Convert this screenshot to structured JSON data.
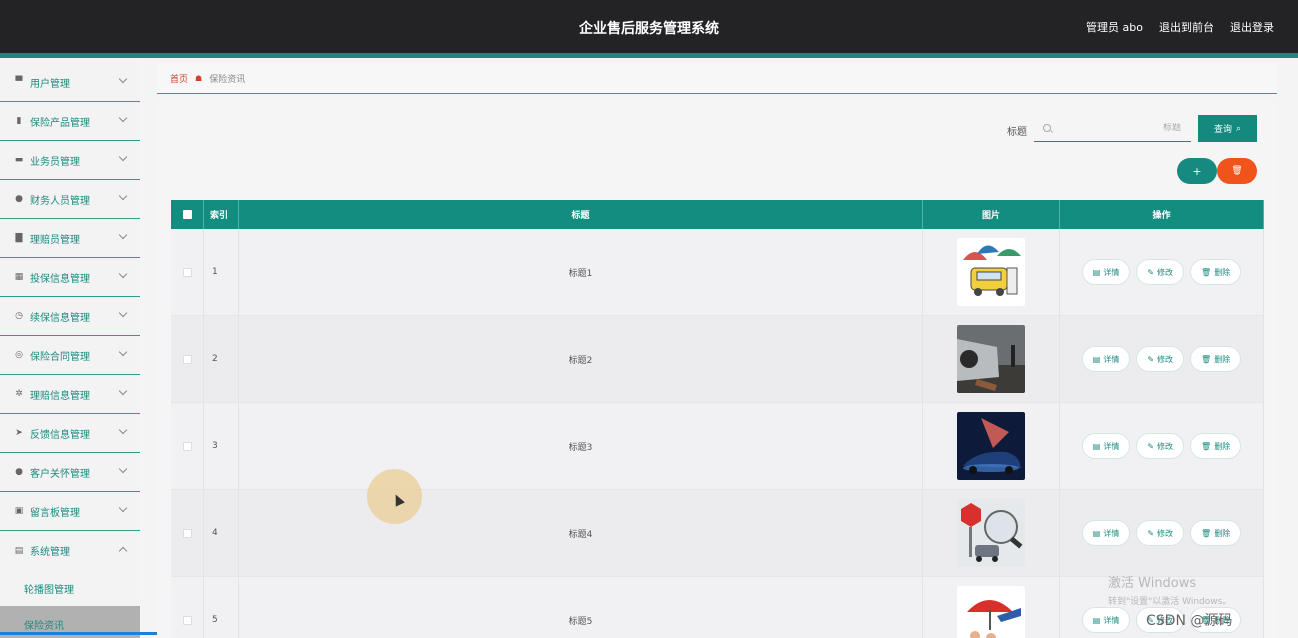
{
  "header": {
    "title": "企业售后服务管理系统",
    "admin": "管理员 abo",
    "back_front": "退出到前台",
    "logout": "退出登录"
  },
  "sidebar": {
    "items": [
      {
        "label": "用户管理",
        "icon": "user-manage-icon"
      },
      {
        "label": "保险产品管理",
        "icon": "product-icon"
      },
      {
        "label": "业务员管理",
        "icon": "monitor-icon"
      },
      {
        "label": "财务人员管理",
        "icon": "person-icon"
      },
      {
        "label": "理赔员管理",
        "icon": "bar-chart-icon"
      },
      {
        "label": "投保信息管理",
        "icon": "grid-icon"
      },
      {
        "label": "续保信息管理",
        "icon": "clock-icon"
      },
      {
        "label": "保险合同管理",
        "icon": "circle-icon"
      },
      {
        "label": "理赔信息管理",
        "icon": "compass-icon"
      },
      {
        "label": "反馈信息管理",
        "icon": "send-icon"
      },
      {
        "label": "客户关怀管理",
        "icon": "person-icon"
      },
      {
        "label": "留言板管理",
        "icon": "briefcase-icon"
      },
      {
        "label": "系统管理",
        "icon": "doc-icon"
      }
    ],
    "sub_items": [
      {
        "label": "轮播图管理"
      },
      {
        "label": "保险资讯"
      }
    ]
  },
  "breadcrumb": {
    "home": "首页",
    "current": "保险资讯"
  },
  "search": {
    "label": "标题",
    "placeholder": "标题",
    "button": "查询"
  },
  "toolbar": {
    "add": "+",
    "delete": "🗑"
  },
  "table": {
    "headers": {
      "index": "索引",
      "title": "标题",
      "image": "图片",
      "action": "操作"
    },
    "rows": [
      {
        "index": "1",
        "title": "标题1"
      },
      {
        "index": "2",
        "title": "标题2"
      },
      {
        "index": "3",
        "title": "标题3"
      },
      {
        "index": "4",
        "title": "标题4"
      },
      {
        "index": "5",
        "title": "标题5"
      }
    ],
    "actions": {
      "detail": "详情",
      "edit": "修改",
      "delete": "删除"
    }
  },
  "watermark": {
    "line1": "激活 Windows",
    "line2": "转到\"设置\"以激活 Windows。",
    "csdn": "CSDN @源码"
  },
  "colors": {
    "accent": "#14897e",
    "danger": "#f0541a",
    "header_bg": "#232325"
  }
}
